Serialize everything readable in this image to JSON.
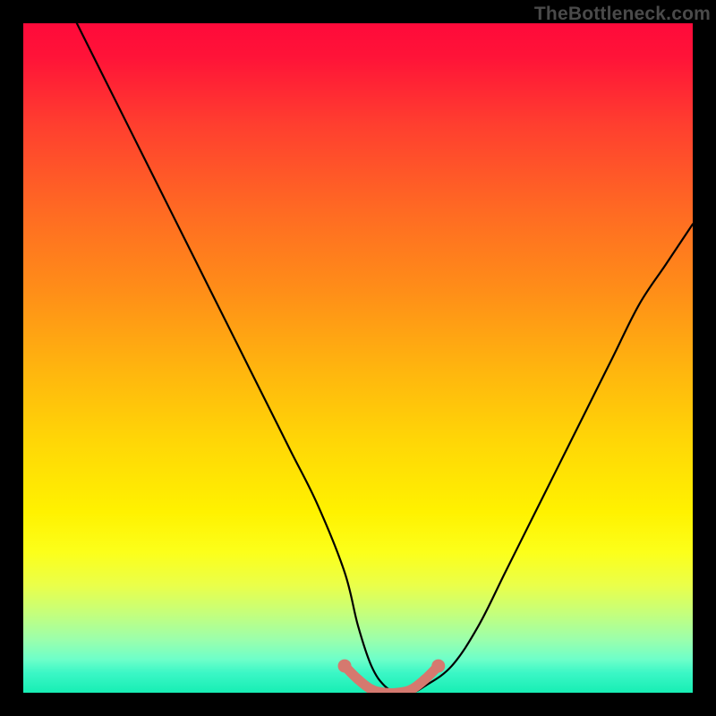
{
  "watermark": "TheBottleneck.com",
  "chart_data": {
    "type": "line",
    "title": "",
    "xlabel": "",
    "ylabel": "",
    "xlim": [
      0,
      100
    ],
    "ylim": [
      0,
      100
    ],
    "grid": false,
    "series": [
      {
        "name": "bottleneck-curve",
        "x": [
          8,
          12,
          16,
          20,
          24,
          28,
          32,
          36,
          40,
          44,
          48,
          50,
          52,
          54,
          56,
          58,
          60,
          64,
          68,
          72,
          76,
          80,
          84,
          88,
          92,
          96,
          100
        ],
        "y": [
          100,
          92,
          84,
          76,
          68,
          60,
          52,
          44,
          36,
          28,
          18,
          10,
          4,
          1,
          0,
          0,
          1,
          4,
          10,
          18,
          26,
          34,
          42,
          50,
          58,
          64,
          70
        ]
      },
      {
        "name": "optimal-band",
        "x": [
          48,
          50,
          52,
          54,
          56,
          58,
          60,
          62
        ],
        "y": [
          4,
          2,
          0.5,
          0,
          0,
          0.5,
          2,
          4
        ]
      }
    ],
    "colors": {
      "curve": "#000000",
      "band": "#d5796f"
    }
  }
}
